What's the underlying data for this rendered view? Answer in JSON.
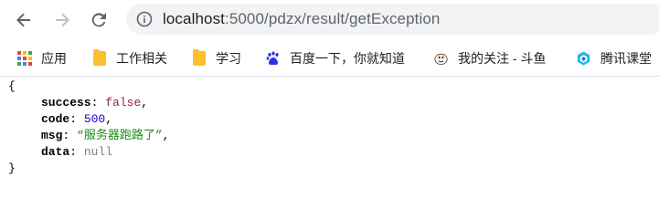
{
  "browser": {
    "url_host": "localhost",
    "url_path": ":5000/pdzx/result/getException"
  },
  "bookmarks": [
    {
      "label": "应用",
      "icon": "apps-grid-icon"
    },
    {
      "label": "工作相关",
      "icon": "folder-icon"
    },
    {
      "label": "学习",
      "icon": "folder-icon"
    },
    {
      "label": "百度一下，你就知道",
      "icon": "baidu-paw-icon"
    },
    {
      "label": "我的关注 - 斗鱼",
      "icon": "douyu-fish-icon"
    },
    {
      "label": "腾讯课堂",
      "icon": "tencent-classroom-icon"
    }
  ],
  "json_view": {
    "open_brace": "{",
    "close_brace": "}",
    "fields": [
      {
        "key": "success",
        "value": "false",
        "type": "bool",
        "comma": ","
      },
      {
        "key": "code",
        "value": "500",
        "type": "num",
        "comma": ","
      },
      {
        "key": "msg",
        "value": "“服务器跑路了”",
        "type": "str",
        "comma": ","
      },
      {
        "key": "data",
        "value": "null",
        "type": "null",
        "comma": ""
      }
    ]
  },
  "colors": {
    "bool": "#8b2252",
    "number": "#1c00cf",
    "string": "#1a8a1a",
    "null": "#808080"
  }
}
